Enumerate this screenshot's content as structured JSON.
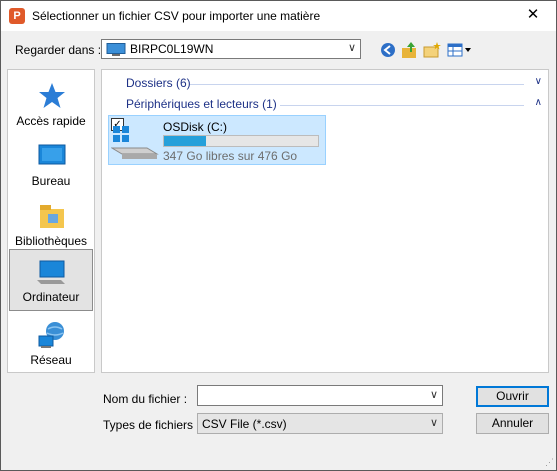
{
  "window": {
    "title": "Sélectionner un fichier CSV pour importer une matière",
    "app_icon_letter": "P",
    "close_glyph": "✕"
  },
  "lookin": {
    "label": "Regarder dans :",
    "value": "BIRPC0L19WN"
  },
  "places": [
    {
      "label": "Accès rapide",
      "icon": "star-icon"
    },
    {
      "label": "Bureau",
      "icon": "desktop-icon"
    },
    {
      "label": "Bibliothèques",
      "icon": "library-icon"
    },
    {
      "label": "Ordinateur",
      "icon": "computer-icon",
      "selected": true
    },
    {
      "label": "Réseau",
      "icon": "network-icon"
    }
  ],
  "groups": {
    "folders": "Dossiers (6)",
    "devices": "Périphériques et lecteurs (1)"
  },
  "drive": {
    "name": "OSDisk (C:)",
    "free_text": "347 Go libres sur 476 Go",
    "used_fraction": 0.27
  },
  "filename": {
    "label": "Nom du fichier :",
    "value": ""
  },
  "filetype": {
    "label": "Types de fichiers :",
    "value": "CSV File (*.csv)"
  },
  "buttons": {
    "open": "Ouvrir",
    "cancel": "Annuler"
  },
  "colors": {
    "accent": "#0078d7",
    "selection": "#cce8ff",
    "group_header": "#1e3287",
    "progress": "#26a0da"
  }
}
